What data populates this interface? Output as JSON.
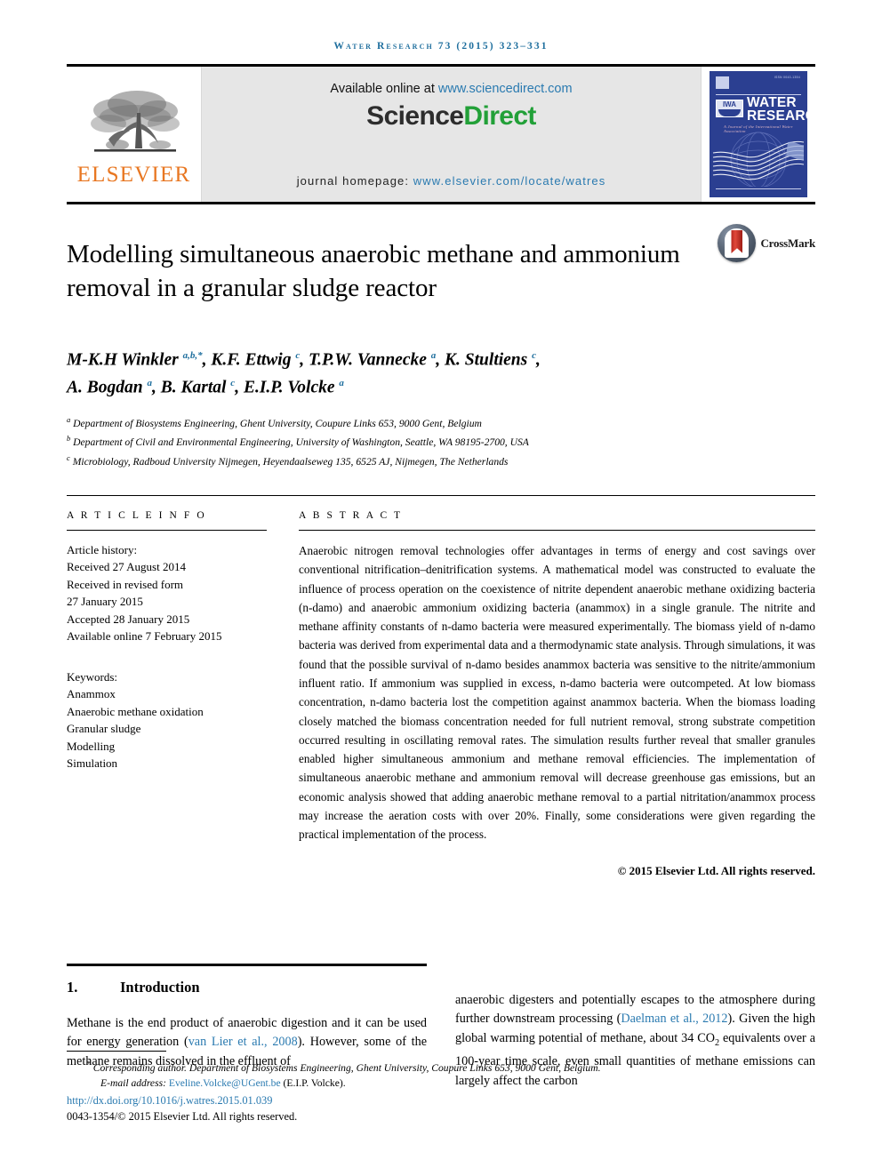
{
  "running_head": "Water Research 73 (2015) 323–331",
  "masthead": {
    "publisher_logo_text": "ELSEVIER",
    "available_prefix": "Available online at",
    "available_url": "www.sciencedirect.com",
    "sciencedirect_part1": "Science",
    "sciencedirect_part2": "Direct",
    "homepage_prefix": "journal homepage:",
    "homepage_url": "www.elsevier.com/locate/watres",
    "cover": {
      "title_line1": "WATER",
      "title_line2": "RESEARCH",
      "subtitle": "A Journal of the International Water Association",
      "issn": "ISSN 0043-1354",
      "badge_text": "IWA"
    }
  },
  "article": {
    "title": "Modelling simultaneous anaerobic methane and ammonium removal in a granular sludge reactor",
    "crossmark_label": "CrossMark",
    "authors_line1": "M-K.H Winkler a,b,*, K.F. Ettwig c, T.P.W. Vannecke a, K. Stultiens c,",
    "authors_line2": "A. Bogdan a, B. Kartal c, E.I.P. Volcke a",
    "authors": [
      {
        "name": "M-K.H Winkler",
        "marks": "a,b,*"
      },
      {
        "name": "K.F. Ettwig",
        "marks": "c"
      },
      {
        "name": "T.P.W. Vannecke",
        "marks": "a"
      },
      {
        "name": "K. Stultiens",
        "marks": "c"
      },
      {
        "name": "A. Bogdan",
        "marks": "a"
      },
      {
        "name": "B. Kartal",
        "marks": "c"
      },
      {
        "name": "E.I.P. Volcke",
        "marks": "a"
      }
    ],
    "affiliations": [
      {
        "mark": "a",
        "text": "Department of Biosystems Engineering, Ghent University, Coupure Links 653, 9000 Gent, Belgium"
      },
      {
        "mark": "b",
        "text": "Department of Civil and Environmental Engineering, University of Washington, Seattle, WA 98195-2700, USA"
      },
      {
        "mark": "c",
        "text": "Microbiology, Radboud University Nijmegen, Heyendaalseweg 135, 6525 AJ, Nijmegen, The Netherlands"
      }
    ]
  },
  "article_info": {
    "heading": "A R T I C L E   I N F O",
    "history_label": "Article history:",
    "history": [
      "Received 27 August 2014",
      "Received in revised form",
      "27 January 2015",
      "Accepted 28 January 2015",
      "Available online 7 February 2015"
    ],
    "keywords_label": "Keywords:",
    "keywords": [
      "Anammox",
      "Anaerobic methane oxidation",
      "Granular sludge",
      "Modelling",
      "Simulation"
    ]
  },
  "abstract": {
    "heading": "A B S T R A C T",
    "text": "Anaerobic nitrogen removal technologies offer advantages in terms of energy and cost savings over conventional nitrification–denitrification systems. A mathematical model was constructed to evaluate the influence of process operation on the coexistence of nitrite dependent anaerobic methane oxidizing bacteria (n-damo) and anaerobic ammonium oxidizing bacteria (anammox) in a single granule. The nitrite and methane affinity constants of n-damo bacteria were measured experimentally. The biomass yield of n-damo bacteria was derived from experimental data and a thermodynamic state analysis. Through simulations, it was found that the possible survival of n-damo besides anammox bacteria was sensitive to the nitrite/ammonium influent ratio. If ammonium was supplied in excess, n-damo bacteria were outcompeted. At low biomass concentration, n-damo bacteria lost the competition against anammox bacteria. When the biomass loading closely matched the biomass concentration needed for full nutrient removal, strong substrate competition occurred resulting in oscillating removal rates. The simulation results further reveal that smaller granules enabled higher simultaneous ammonium and methane removal efficiencies. The implementation of simultaneous anaerobic methane and ammonium removal will decrease greenhouse gas emissions, but an economic analysis showed that adding anaerobic methane removal to a partial nitritation/anammox process may increase the aeration costs with over 20%. Finally, some considerations were given regarding the practical implementation of the process.",
    "copyright": "© 2015 Elsevier Ltd. All rights reserved."
  },
  "body": {
    "section_number": "1.",
    "section_title": "Introduction",
    "left_text_pre": "Methane is the end product of anaerobic digestion and it can be used for energy generation (",
    "left_citation": "van Lier et al., 2008",
    "left_text_post": "). However, some of the methane remains dissolved in the effluent of",
    "right_text_pre": "anaerobic digesters and potentially escapes to the atmosphere during further downstream processing (",
    "right_citation": "Daelman et al., 2012",
    "right_text_mid": "). Given the high global warming potential of methane, about 34 CO",
    "right_sub": "2",
    "right_text_post": " equivalents over a 100-year time scale, even small quantities of methane emissions can largely affect the carbon"
  },
  "footer": {
    "corresponding_mark": "*",
    "corresponding_label": "Corresponding author.",
    "corresponding_text": " Department of Biosystems Engineering, Ghent University, Coupure Links 653, 9000 Gent, Belgium.",
    "email_label": "E-mail address:",
    "email": "Eveline.Volcke@UGent.be",
    "email_owner": "(E.I.P. Volcke).",
    "doi": "http://dx.doi.org/10.1016/j.watres.2015.01.039",
    "issn_line": "0043-1354/© 2015 Elsevier Ltd. All rights reserved."
  },
  "colors": {
    "link": "#2a7ab0",
    "elsevier_orange": "#E87722",
    "sciencedirect_green": "#22a038",
    "journal_blue": "#2b3f91",
    "crossmark_red": "#b3251d"
  }
}
